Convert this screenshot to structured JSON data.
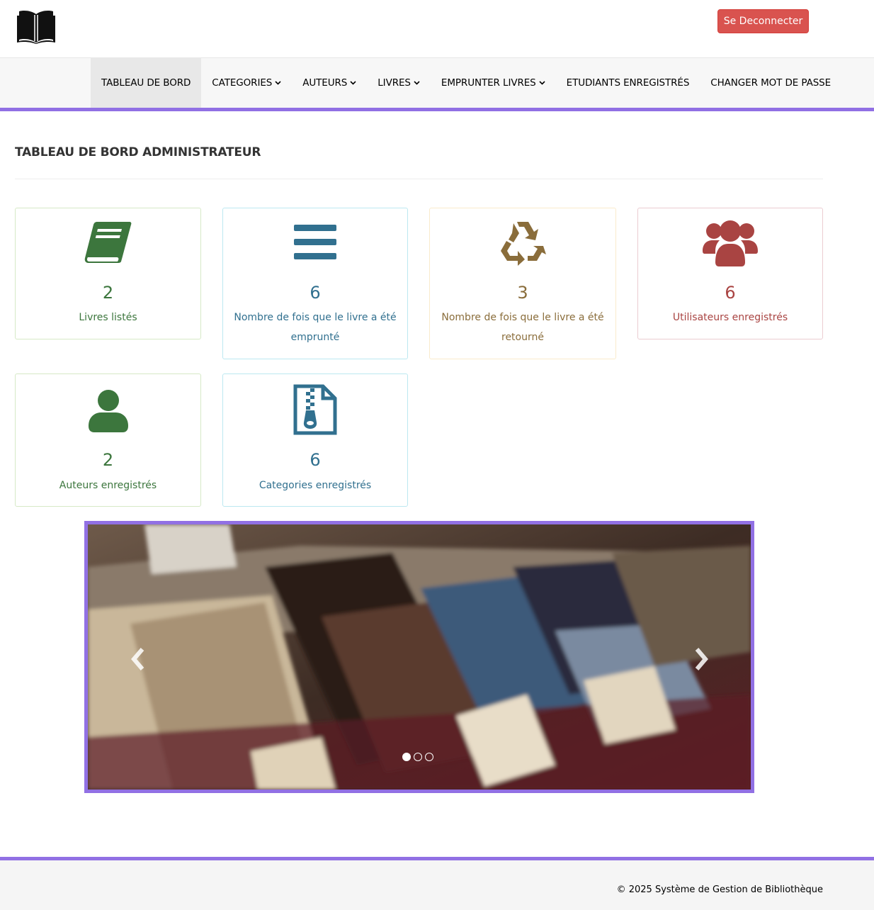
{
  "header": {
    "logo": "open-book-icon",
    "logout_label": "Se Deconnecter",
    "logout_color": "#d9534f"
  },
  "nav": {
    "items": [
      {
        "label": "TABLEAU DE BORD",
        "active": true,
        "dropdown": false
      },
      {
        "label": "CATEGORIES",
        "dropdown": true
      },
      {
        "label": "AUTEURS",
        "dropdown": true
      },
      {
        "label": "LIVRES",
        "dropdown": true
      },
      {
        "label": "EMPRUNTER LIVRES",
        "dropdown": true
      },
      {
        "label": "ETUDIANTS ENREGISTRÉS",
        "dropdown": false
      },
      {
        "label": "CHANGER MOT DE PASSE",
        "dropdown": false
      }
    ],
    "accent": "#9170e4"
  },
  "main": {
    "title": "TABLEAU DE BORD ADMINISTRATEUR",
    "cards": [
      {
        "icon": "book-icon",
        "count": "2",
        "label": "Livres listés",
        "color": "#3c763d"
      },
      {
        "icon": "bars-icon",
        "count": "6",
        "label": "Nombre de fois que le livre a été emprunté",
        "color": "#31708f"
      },
      {
        "icon": "recycle-icon",
        "count": "3",
        "label": "Nombre de fois que le livre a été retourné",
        "color": "#8a6d3b"
      },
      {
        "icon": "users-icon",
        "count": "6",
        "label": "Utilisateurs enregistrés",
        "color": "#a94442"
      },
      {
        "icon": "user-icon",
        "count": "2",
        "label": "Auteurs enregistrés",
        "color": "#3c763d"
      },
      {
        "icon": "file-archive-icon",
        "count": "6",
        "label": "Categories enregistrés",
        "color": "#31708f"
      }
    ]
  },
  "carousel": {
    "slides": 3,
    "active_slide": 1
  },
  "footer": {
    "text": "© 2025 Système de Gestion de Bibliothèque"
  }
}
